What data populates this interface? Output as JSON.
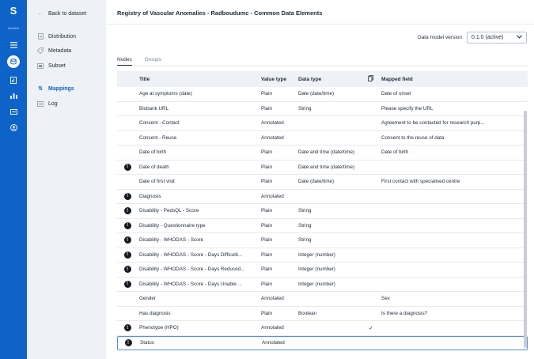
{
  "rail": {
    "logo": "S",
    "avatar": "AAAAA"
  },
  "sidebar": {
    "back_label": "Back to dataset",
    "items": [
      {
        "label": "Distribution",
        "icon": "document-icon"
      },
      {
        "label": "Metadata",
        "icon": "tag-icon"
      },
      {
        "label": "Subset",
        "icon": "subset-icon"
      },
      {
        "label": "Mappings",
        "icon": "mapping-icon",
        "active": true
      },
      {
        "label": "Log",
        "icon": "list-icon"
      }
    ]
  },
  "header": {
    "title": "Registry of Vascular Anomalies - Radboudumc - Common Data Elements",
    "version_label": "Data model version",
    "version_value": "0.1.0 (active)"
  },
  "tabs": [
    {
      "label": "Nodes",
      "active": true
    },
    {
      "label": "Groups",
      "active": false
    }
  ],
  "table": {
    "headers": {
      "title": "Title",
      "value_type": "Value type",
      "data_type": "Data type",
      "mapped_field": "Mapped field"
    },
    "rows": [
      {
        "warn": false,
        "title": "Age at symptoms (date)",
        "value_type": "Plain",
        "data_type": "Date (date/time)",
        "check": false,
        "mapped": "Date of onset"
      },
      {
        "warn": false,
        "title": "Biobank URL",
        "value_type": "Plain",
        "data_type": "String",
        "check": false,
        "mapped": "Please specify the URL"
      },
      {
        "warn": false,
        "title": "Consent - Contact",
        "value_type": "Annotated",
        "data_type": "",
        "check": false,
        "mapped": "Agreement to be contacted for research purp..."
      },
      {
        "warn": false,
        "title": "Consent - Reuse",
        "value_type": "Annotated",
        "data_type": "",
        "check": false,
        "mapped": "Consent to the reuse of data"
      },
      {
        "warn": false,
        "title": "Date of birth",
        "value_type": "Plain",
        "data_type": "Date and time (date/time)",
        "check": false,
        "mapped": "Date of birth"
      },
      {
        "warn": true,
        "title": "Date of death",
        "value_type": "Plain",
        "data_type": "Date and time (date/time)",
        "check": false,
        "mapped": ""
      },
      {
        "warn": false,
        "title": "Date of first visit",
        "value_type": "Plain",
        "data_type": "Date (date/time)",
        "check": false,
        "mapped": "First contact with specialised centre"
      },
      {
        "warn": true,
        "title": "Diagnosis",
        "value_type": "Annotated",
        "data_type": "",
        "check": false,
        "mapped": ""
      },
      {
        "warn": true,
        "title": "Disability - PedsQL - Score",
        "value_type": "Plain",
        "data_type": "String",
        "check": false,
        "mapped": ""
      },
      {
        "warn": true,
        "title": "Disability - Questionnaire type",
        "value_type": "Plain",
        "data_type": "String",
        "check": false,
        "mapped": ""
      },
      {
        "warn": true,
        "title": "Disability - WHODAS - Score",
        "value_type": "Plain",
        "data_type": "String",
        "check": false,
        "mapped": ""
      },
      {
        "warn": true,
        "title": "Disability - WHODAS - Score - Days Difficulti...",
        "value_type": "Plain",
        "data_type": "Integer (number)",
        "check": false,
        "mapped": ""
      },
      {
        "warn": true,
        "title": "Disability - WHODAS - Score - Days Reduced...",
        "value_type": "Plain",
        "data_type": "Integer (number)",
        "check": false,
        "mapped": ""
      },
      {
        "warn": true,
        "title": "Disability - WHODAS - Score - Days Unable ...",
        "value_type": "Plain",
        "data_type": "Integer (number)",
        "check": false,
        "mapped": ""
      },
      {
        "warn": false,
        "title": "Gender",
        "value_type": "Annotated",
        "data_type": "",
        "check": false,
        "mapped": "Sex"
      },
      {
        "warn": false,
        "title": "Has diagnosis",
        "value_type": "Plain",
        "data_type": "Boolean",
        "check": false,
        "mapped": "Is there a diagnosis?"
      },
      {
        "warn": true,
        "title": "Phenotype (HPO)",
        "value_type": "Annotated",
        "data_type": "",
        "check": true,
        "mapped": ""
      },
      {
        "warn": true,
        "title": "Status",
        "value_type": "Annotated",
        "data_type": "",
        "check": false,
        "mapped": "",
        "selected": true
      }
    ]
  }
}
